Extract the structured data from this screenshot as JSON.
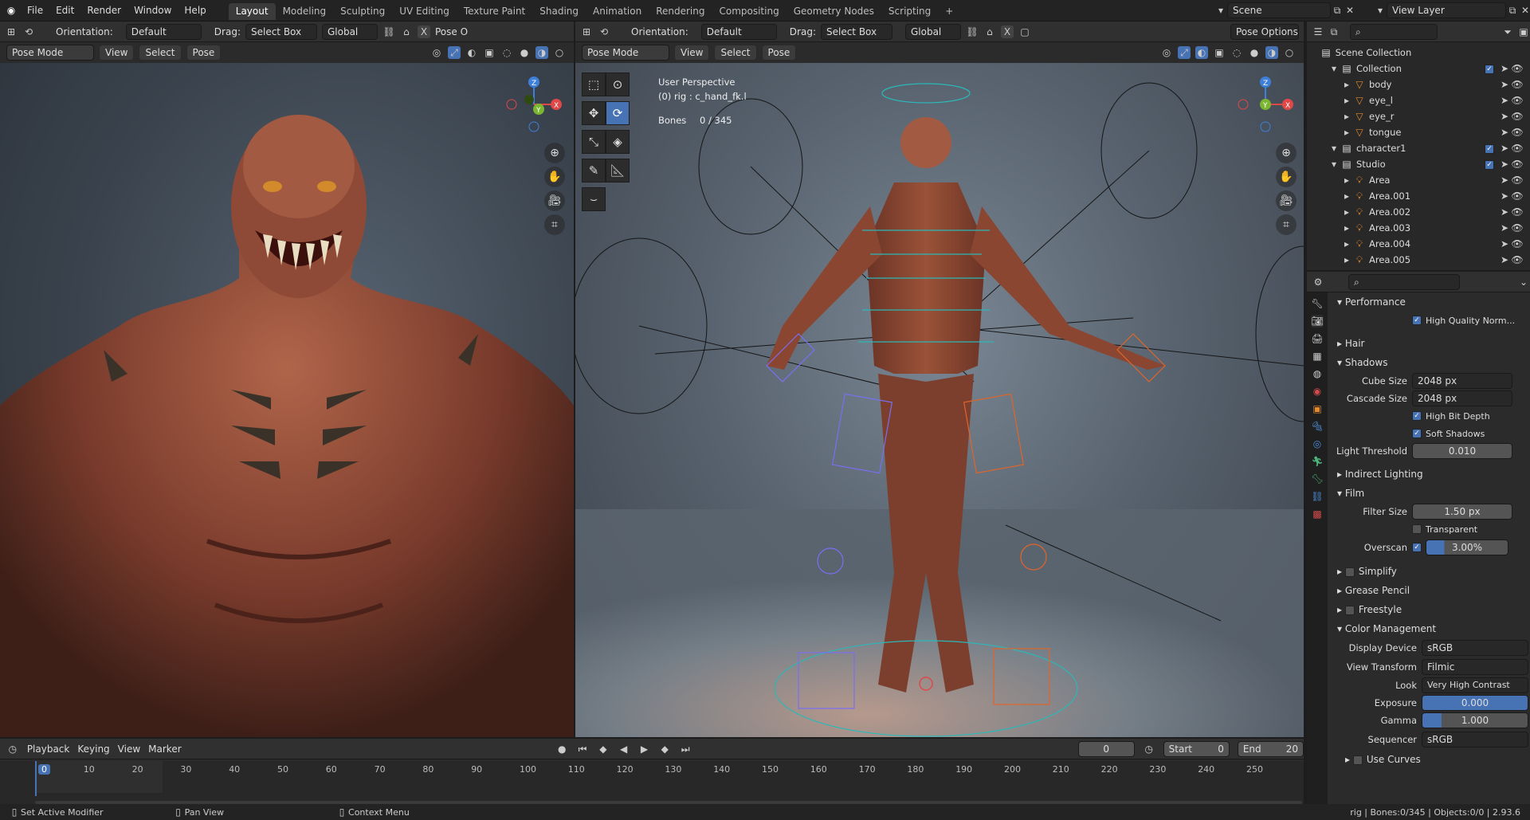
{
  "menu": {
    "file": "File",
    "edit": "Edit",
    "render": "Render",
    "window": "Window",
    "help": "Help"
  },
  "workspaces": [
    "Layout",
    "Modeling",
    "Sculpting",
    "UV Editing",
    "Texture Paint",
    "Shading",
    "Animation",
    "Rendering",
    "Compositing",
    "Geometry Nodes",
    "Scripting"
  ],
  "active_workspace": "Layout",
  "scene": {
    "label": "Scene",
    "view_layer": "View Layer"
  },
  "tool_header": {
    "orientation_label": "Orientation:",
    "orientation_value": "Default",
    "drag_label": "Drag:",
    "drag_value": "Select Box",
    "transform_value": "Global",
    "pose_options_short": "Pose O",
    "pose_options": "Pose Options"
  },
  "viewport_header": {
    "mode": "Pose Mode",
    "view": "View",
    "select": "Select",
    "pose": "Pose"
  },
  "overlay_text": {
    "perspective": "User Perspective",
    "object": "(0) rig : c_hand_fk.l",
    "bones_label": "Bones",
    "bones_value": "0 / 345"
  },
  "gizmo": {
    "x": "X",
    "y": "Y",
    "z": "Z"
  },
  "outliner": {
    "root": "Scene Collection",
    "items": [
      {
        "name": "Collection",
        "depth": 0
      },
      {
        "name": "body",
        "depth": 1
      },
      {
        "name": "eye_l",
        "depth": 1
      },
      {
        "name": "eye_r",
        "depth": 1
      },
      {
        "name": "tongue",
        "depth": 1
      },
      {
        "name": "character1",
        "depth": 0
      },
      {
        "name": "Studio",
        "depth": 0
      },
      {
        "name": "Area",
        "depth": 1
      },
      {
        "name": "Area.001",
        "depth": 1
      },
      {
        "name": "Area.002",
        "depth": 1
      },
      {
        "name": "Area.003",
        "depth": 1
      },
      {
        "name": "Area.004",
        "depth": 1
      },
      {
        "name": "Area.005",
        "depth": 1
      }
    ]
  },
  "properties": {
    "performance": "Performance",
    "high_quality_normals": "High Quality Norm...",
    "hair": "Hair",
    "shadows": "Shadows",
    "cube_size_label": "Cube Size",
    "cube_size": "2048 px",
    "cascade_size_label": "Cascade Size",
    "cascade_size": "2048 px",
    "high_bit_depth": "High Bit Depth",
    "soft_shadows": "Soft Shadows",
    "light_threshold_label": "Light Threshold",
    "light_threshold": "0.010",
    "indirect_lighting": "Indirect Lighting",
    "film": "Film",
    "filter_size_label": "Filter Size",
    "filter_size": "1.50 px",
    "transparent": "Transparent",
    "overscan_label": "Overscan",
    "overscan": "3.00%",
    "simplify": "Simplify",
    "grease_pencil": "Grease Pencil",
    "freestyle": "Freestyle",
    "color_management": "Color Management",
    "display_device_label": "Display Device",
    "display_device": "sRGB",
    "view_transform_label": "View Transform",
    "view_transform": "Filmic",
    "look_label": "Look",
    "look": "Very High Contrast",
    "exposure_label": "Exposure",
    "exposure": "0.000",
    "gamma_label": "Gamma",
    "gamma": "1.000",
    "sequencer_label": "Sequencer",
    "sequencer": "sRGB",
    "use_curves": "Use Curves"
  },
  "timeline": {
    "playback": "Playback",
    "keying": "Keying",
    "view": "View",
    "marker": "Marker",
    "current_frame": "0",
    "start_label": "Start",
    "start": "0",
    "end_label": "End",
    "end": "20",
    "ticks": [
      "0",
      "10",
      "20",
      "30",
      "40",
      "50",
      "60",
      "70",
      "80",
      "90",
      "100",
      "110",
      "120",
      "130",
      "140",
      "150",
      "160",
      "170",
      "180",
      "190",
      "200",
      "210",
      "220",
      "230",
      "240",
      "250"
    ]
  },
  "status": {
    "left": "Set Active Modifier",
    "middle": "Pan View",
    "right_action": "Context Menu",
    "stats": "rig | Bones:0/345 | Objects:0/0 | 2.93.6"
  },
  "colors": {
    "accent": "#4772b3",
    "bg": "#1d1d1d",
    "header": "#303030"
  }
}
